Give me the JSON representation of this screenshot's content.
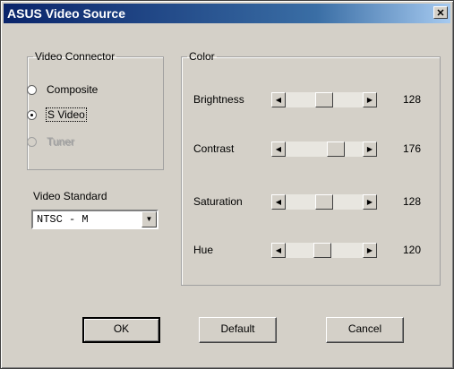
{
  "window": {
    "title": "ASUS Video Source",
    "close_glyph": "✕"
  },
  "video_connector": {
    "legend": "Video Connector",
    "options": [
      {
        "label": "Composite",
        "selected": false,
        "enabled": true
      },
      {
        "label": "S Video",
        "selected": true,
        "enabled": true
      },
      {
        "label": "Tuner",
        "selected": false,
        "enabled": false
      }
    ]
  },
  "video_standard": {
    "label": "Video Standard",
    "selected": "NTSC - M",
    "dropdown_glyph": "▼"
  },
  "color": {
    "legend": "Color",
    "range": [
      0,
      255
    ],
    "left_arrow_glyph": "◀",
    "right_arrow_glyph": "▶",
    "sliders": [
      {
        "label": "Brightness",
        "value": "128",
        "level": 128
      },
      {
        "label": "Contrast",
        "value": "176",
        "level": 176
      },
      {
        "label": "Saturation",
        "value": "128",
        "level": 128
      },
      {
        "label": "Hue",
        "value": "120",
        "level": 120
      }
    ]
  },
  "buttons": {
    "ok": "OK",
    "default": "Default",
    "cancel": "Cancel"
  }
}
